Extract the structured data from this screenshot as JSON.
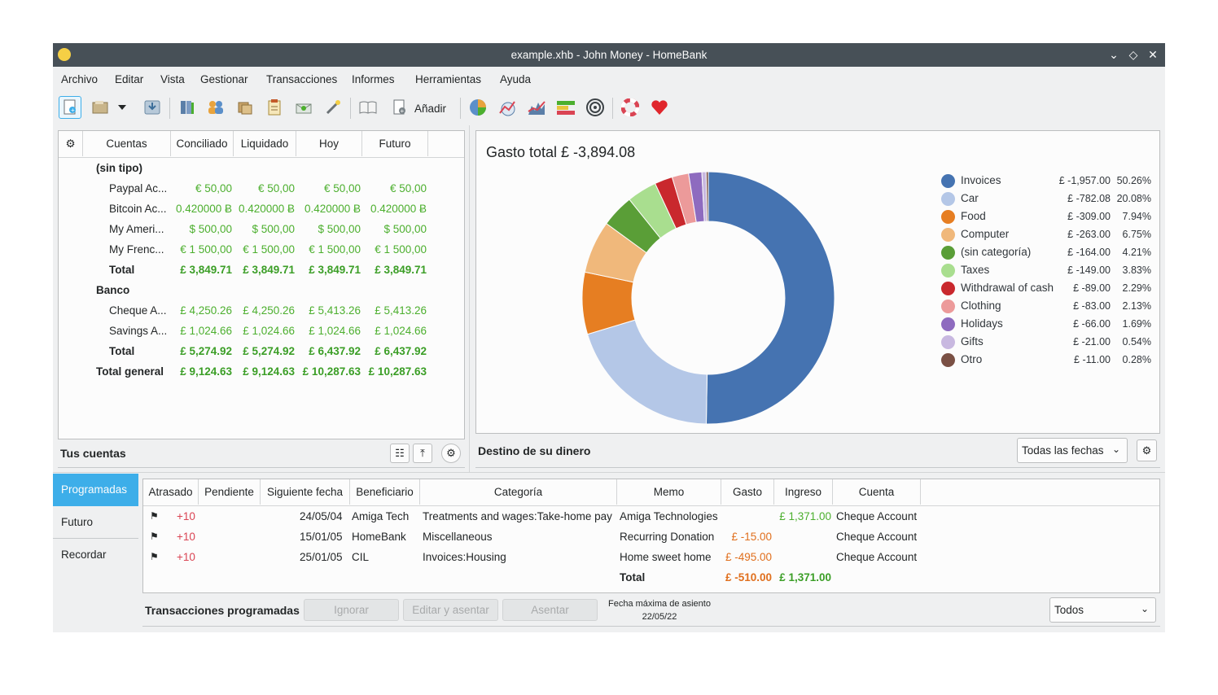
{
  "window": {
    "title": "example.xhb - John Money - HomeBank"
  },
  "menu": [
    "Archivo",
    "Editar",
    "Vista",
    "Gestionar",
    "Transacciones",
    "Informes",
    "Herramientas",
    "Ayuda"
  ],
  "toolbar": {
    "icons": [
      "new-file-icon",
      "open-file-icon",
      "dropdown-arrow-icon",
      "save-icon",
      "accounts-icon",
      "payees-icon",
      "categories-icon",
      "budget-icon",
      "archives-icon",
      "assign-wand-icon",
      "ledger-book-icon",
      "add-transaction-icon",
      "statistics-pie-icon",
      "trend-time-icon",
      "balance-report-icon",
      "budget-report-icon",
      "vehicle-cost-icon",
      "help-lifebuoy-icon",
      "donate-heart-icon"
    ],
    "add_label": "Añadir"
  },
  "accounts": {
    "columns": [
      "Cuentas",
      "Conciliado",
      "Liquidado",
      "Hoy",
      "Futuro"
    ],
    "groups": [
      {
        "title": "(sin tipo)",
        "rows": [
          {
            "name": "Paypal Ac...",
            "vals": [
              "€ 50,00",
              "€ 50,00",
              "€ 50,00",
              "€ 50,00"
            ]
          },
          {
            "name": "Bitcoin Ac...",
            "vals": [
              "0.420000 Ƀ",
              "0.420000 Ƀ",
              "0.420000 Ƀ",
              "0.420000 Ƀ"
            ]
          },
          {
            "name": "My Ameri...",
            "vals": [
              "$ 500,00",
              "$ 500,00",
              "$ 500,00",
              "$ 500,00"
            ]
          },
          {
            "name": "My Frenc...",
            "vals": [
              "€ 1 500,00",
              "€ 1 500,00",
              "€ 1 500,00",
              "€ 1 500,00"
            ]
          }
        ],
        "total_label": "Total",
        "total": [
          "£ 3,849.71",
          "£ 3,849.71",
          "£ 3,849.71",
          "£ 3,849.71"
        ]
      },
      {
        "title": "Banco",
        "rows": [
          {
            "name": "Cheque A...",
            "vals": [
              "£ 4,250.26",
              "£ 4,250.26",
              "£ 5,413.26",
              "£ 5,413.26"
            ]
          },
          {
            "name": "Savings A...",
            "vals": [
              "£ 1,024.66",
              "£ 1,024.66",
              "£ 1,024.66",
              "£ 1,024.66"
            ]
          }
        ],
        "total_label": "Total",
        "total": [
          "£ 5,274.92",
          "£ 5,274.92",
          "£ 6,437.92",
          "£ 6,437.92"
        ]
      }
    ],
    "grand_label": "Total general",
    "grand": [
      "£ 9,124.63",
      "£ 9,124.63",
      "£ 10,287.63",
      "£ 10,287.63"
    ],
    "panel_title": "Tus cuentas"
  },
  "spending": {
    "panel_title": "Destino de su dinero",
    "range": "Todas las fechas"
  },
  "chart_data": {
    "type": "pie",
    "title": "Gasto total £ -3,894.08",
    "categories": [
      "Invoices",
      "Car",
      "Food",
      "Computer",
      "(sin categoría)",
      "Taxes",
      "Withdrawal of cash",
      "Clothing",
      "Holidays",
      "Gifts",
      "Otro"
    ],
    "values": [
      -1957.0,
      -782.08,
      -309.0,
      -263.0,
      -164.0,
      -149.0,
      -89.0,
      -83.0,
      -66.0,
      -21.0,
      -11.0
    ],
    "amount_labels": [
      "£ -1,957.00",
      "£ -782.08",
      "£ -309.00",
      "£ -263.00",
      "£ -164.00",
      "£ -149.00",
      "£ -89.00",
      "£ -83.00",
      "£ -66.00",
      "£ -21.00",
      "£ -11.00"
    ],
    "percent_labels": [
      "50.26%",
      "20.08%",
      "7.94%",
      "6.75%",
      "4.21%",
      "3.83%",
      "2.29%",
      "2.13%",
      "1.69%",
      "0.54%",
      "0.28%"
    ],
    "percents": [
      50.26,
      20.08,
      7.94,
      6.75,
      4.21,
      3.83,
      2.29,
      2.13,
      1.69,
      0.54,
      0.28
    ],
    "colors": [
      "#4573b1",
      "#b4c7e7",
      "#e67e22",
      "#f0b87b",
      "#5a9e37",
      "#a9de8f",
      "#c9282d",
      "#ec9a9a",
      "#8e6bbf",
      "#c8b8e0",
      "#7a5044"
    ],
    "donut": true,
    "legend_position": "right"
  },
  "sidetabs": [
    "Programadas",
    "Futuro",
    "Recordar"
  ],
  "scheduled": {
    "columns": [
      "Atrasado",
      "Pendiente",
      "Siguiente fecha",
      "Beneficiario",
      "Categoría",
      "Memo",
      "Gasto",
      "Ingreso",
      "Cuenta"
    ],
    "rows": [
      {
        "late": "+10",
        "date": "24/05/04",
        "payee": "Amiga Tech",
        "category": "Treatments and wages:Take-home pay",
        "memo": "Amiga Technologies",
        "expense": "",
        "income": "£ 1,371.00",
        "account": "Cheque Account"
      },
      {
        "late": "+10",
        "date": "15/01/05",
        "payee": "HomeBank",
        "category": "Miscellaneous",
        "memo": "Recurring Donation",
        "expense": "£ -15.00",
        "income": "",
        "account": "Cheque Account"
      },
      {
        "late": "+10",
        "date": "25/01/05",
        "payee": "CIL",
        "category": "Invoices:Housing",
        "memo": "Home sweet home",
        "expense": "£ -495.00",
        "income": "",
        "account": "Cheque Account"
      }
    ],
    "total_label": "Total",
    "total_expense": "£ -510.00",
    "total_income": "£ 1,371.00",
    "panel_title": "Transacciones programadas",
    "buttons": {
      "skip": "Ignorar",
      "edit_post": "Editar y asentar",
      "post": "Asentar"
    },
    "max_date_label": "Fecha máxima de asiento",
    "max_date": "22/05/22",
    "filter": "Todos"
  }
}
